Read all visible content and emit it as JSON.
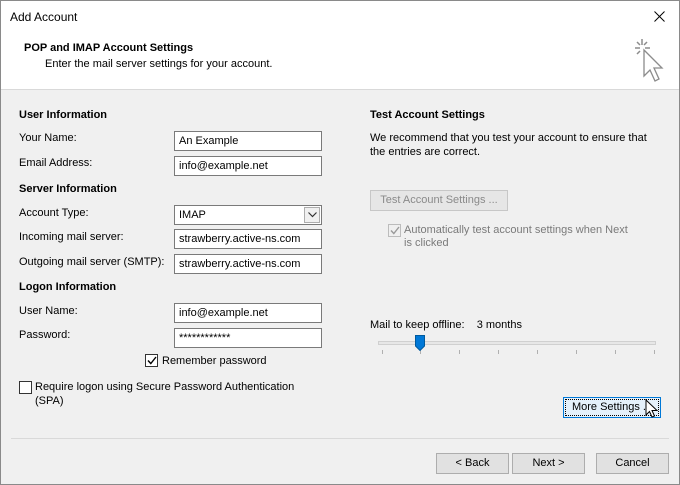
{
  "window": {
    "title": "Add Account"
  },
  "header": {
    "title": "POP and IMAP Account Settings",
    "subtitle": "Enter the mail server settings for your account."
  },
  "user_info": {
    "heading": "User Information",
    "name_label": "Your Name:",
    "name_value": "An Example",
    "email_label": "Email Address:",
    "email_value": "info@example.net"
  },
  "server_info": {
    "heading": "Server Information",
    "account_type_label": "Account Type:",
    "account_type_value": "IMAP",
    "incoming_label": "Incoming mail server:",
    "incoming_value": "strawberry.active-ns.com",
    "outgoing_label": "Outgoing mail server (SMTP):",
    "outgoing_value": "strawberry.active-ns.com"
  },
  "logon_info": {
    "heading": "Logon Information",
    "username_label": "User Name:",
    "username_value": "info@example.net",
    "password_label": "Password:",
    "password_value": "************",
    "remember_label": "Remember password",
    "remember_checked": true,
    "spa_label_line1": "Require logon using Secure Password Authentication",
    "spa_label_line2": "(SPA)",
    "spa_checked": false
  },
  "test_settings": {
    "heading": "Test Account Settings",
    "description_line1": "We recommend that you test your account to ensure that",
    "description_line2": "the entries are correct.",
    "test_button": "Test Account Settings ...",
    "auto_test_line1": "Automatically test account settings when Next",
    "auto_test_line2": "is clicked",
    "auto_test_checked": true
  },
  "offline": {
    "label": "Mail to keep offline:",
    "value": "3 months",
    "slider_position": 0.14
  },
  "buttons": {
    "more_settings": "More Settings ...",
    "back": "< Back",
    "next": "Next >",
    "cancel": "Cancel"
  },
  "icons": {
    "close": "close-icon",
    "wizard": "cursor-sparkle-icon",
    "dropdown": "chevron-down-icon",
    "check": "checkmark-icon"
  },
  "colors": {
    "focus_border": "#0078d7",
    "window_bg": "#f0f0f0"
  }
}
